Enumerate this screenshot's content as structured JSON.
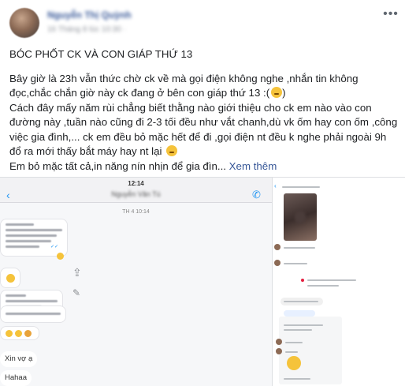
{
  "post": {
    "poster_name": "Nguyễn Thị Quỳnh",
    "post_time": "16 Tháng 8 lúc 10:30 · ",
    "title": "BÓC PHỐT CK VÀ CON GIÁP THỨ 13",
    "paragraph_1": "Bây giờ là 23h vẫn thức chờ ck về mà gọi điện không nghe ,nhắn tin không đọc,chắc chắn giờ này ck đang ở bên con giáp thứ 13 :(",
    "paragraph_2": "Cách đây mấy năm rùi chẳng biết thằng nào giới thiệu cho ck em nào vào con đường này ,tuần nào cũng đi 2-3 tối đều như vắt chanh,dù vk ốm hay con ốm ,công việc gia đình,... ck em đều bỏ mặc hết để đi ,gọi điện nt đều k nghe phải ngoài 9h đổ ra mới thấy bắt máy hay nt lại",
    "paragraph_3": "Em bỏ mặc tất cả,in năng nín nhịn để gia đìn...",
    "see_more": " Xem thêm"
  },
  "chat_left": {
    "status_time": "12:14",
    "contact_name": "Nguyễn Văn Tú",
    "date_stamp": "TH 4 10:14",
    "reply_1": "Xin vợ ạ",
    "reply_2": "Hahaa"
  },
  "icons": {
    "more": "more-horizontal-icon",
    "back": "chevron-left-icon",
    "phone": "phone-icon",
    "share": "share-icon",
    "pen": "pen-icon"
  },
  "colors": {
    "link": "#385898",
    "messenger_blue": "#2196f3",
    "text": "#1c1e21"
  }
}
